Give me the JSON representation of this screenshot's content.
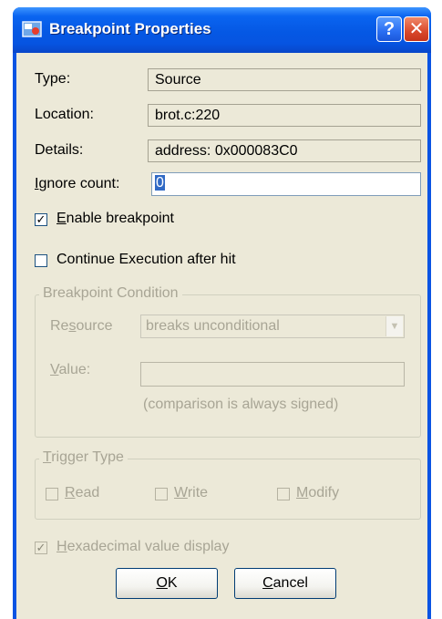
{
  "window": {
    "title": "Breakpoint Properties",
    "help_label": "?",
    "close_label": "✕"
  },
  "fields": {
    "type_label": "Type:",
    "type_value": "Source",
    "location_label": "Location:",
    "location_value": "brot.c:220",
    "details_label": "Details:",
    "details_value": "address: 0x000083C0",
    "ignore_label_accel": "I",
    "ignore_label_rest": "gnore count:",
    "ignore_value": "0"
  },
  "options": {
    "enable_accel": "E",
    "enable_rest": "nable breakpoint",
    "enable_checked": true,
    "continue_label": "Continue Execution after hit",
    "continue_checked": false
  },
  "condition": {
    "legend": "Breakpoint Condition",
    "resource_pre": "Re",
    "resource_accel": "s",
    "resource_post": "ource",
    "resource_value": "breaks unconditional",
    "value_accel": "V",
    "value_rest": "alue:",
    "note": "(comparison is always signed)"
  },
  "trigger": {
    "legend_accel": "T",
    "legend_rest": "rigger Type",
    "read_accel": "R",
    "read_rest": "ead",
    "write_accel": "W",
    "write_rest": "rite",
    "modify_accel": "M",
    "modify_rest": "odify"
  },
  "hex": {
    "accel": "H",
    "rest": "exadecimal value display",
    "checked": true
  },
  "buttons": {
    "ok_accel": "O",
    "ok_rest": "K",
    "cancel_accel": "C",
    "cancel_rest": "ancel"
  }
}
